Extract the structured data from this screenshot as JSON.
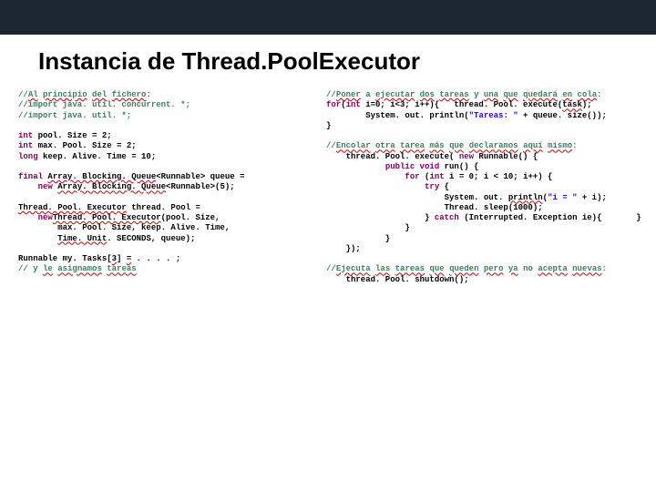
{
  "slide": {
    "title": "Instancia de Thread.PoolExecutor"
  },
  "left": {
    "c1a": "//",
    "c1b": "Al",
    "c1c": " ",
    "c1d": "principio",
    "c1e": " ",
    "c1f": "del",
    "c1g": " ",
    "c1h": "fichero",
    "c1i": ":",
    "c2": "//import java. util. concurrent. *;",
    "c3": "//import java. util. *;",
    "k_int": "int",
    "l4b": " pool. Size = 2;",
    "l5b": " max. Pool. Size = 2;",
    "k_long": "long",
    "l6b": " keep. Alive. Time = 10;",
    "k_final": "final",
    "l7b": " ",
    "l7c": "Array. Blocking. Queue",
    "l7d": "<Runnable> queue =",
    "k_new": "new",
    "l8a": "    ",
    "l8c": " ",
    "l8d": "Array. Blocking. Queue",
    "l8e": "<Runnable>(5);",
    "l9a": "Thread. Pool. Executor",
    "l9b": " thread. Pool =",
    "l10a": "    ",
    "l10c": "Thread. Pool. Executor",
    "l10d": "(pool. Size,",
    "l11": "        max. Pool. Size, keep. Alive. Time,",
    "l12a": "        ",
    "l12b": "Time. Unit",
    "l12c": ". SECONDS, queue);",
    "l13a": "Runnable my. Tasks[",
    "l13b": "3",
    "l13c": "] ",
    "l13d": "=",
    "l13e": " . . . . ;",
    "l14a": "// y ",
    "l14b": "le",
    "l14c": " ",
    "l14d": "asignamos",
    "l14e": " ",
    "l14f": "tareas"
  },
  "right": {
    "c1a": "//",
    "c1b": "Poner",
    "c1c": " a ",
    "c1d": "ejecutar",
    "c1e": " ",
    "c1f": "dos",
    "c1g": " ",
    "c1h": "tareas",
    "c1i": " y ",
    "c1j": "una",
    "c1k": " ",
    "c1l": "que",
    "c1m": " ",
    "c1n": "quedará",
    "c1o": " ",
    "c1p": "en",
    "c1q": " ",
    "c1r": "cola",
    "c1s": ":",
    "k_for": "for",
    "l2a": "(",
    "k_int": "int",
    "l2c": " i=0; i<3; i++){   thread. Pool. execute(",
    "l2d": "task",
    "l2e": ");",
    "l3a": "        System. out. println(",
    "s1": "\"Tareas: \"",
    "l3b": " + queue. size());",
    "l4": "}",
    "c2a": "//",
    "c2b": "Encolar",
    "c2c": " ",
    "c2d": "otra",
    "c2e": " ",
    "c2f": "tarea",
    "c2g": " ",
    "c2h": "más",
    "c2i": " ",
    "c2j": "que",
    "c2k": " ",
    "c2l": "declaramos",
    "c2m": " ",
    "c2n": "aquí",
    "c2o": " ",
    "c2p": "mismo",
    "c2q": ":",
    "l6a": "    thread. Pool. execute( ",
    "k_new": "new",
    "l6b": " Runnable() {",
    "k_public": "public",
    "k_void": "void",
    "l7a": "            ",
    "l7b": " run() {",
    "l8a": "                ",
    "l8b": " (",
    "l8c": " i = 0; i < 10; i++) {",
    "k_try": "try",
    "l9a": "                    ",
    "l9b": " {",
    "l10a": "                        System. out. ",
    "l10b": "println",
    "l10c": "(",
    "s2": "\"i = \"",
    "l10d": " + i);",
    "l11a": "                        Thread. sleep(1000);",
    "k_catch": "catch",
    "l12a": "                    } ",
    "l12b": " (Interrupted. Exception ie){       }",
    "l13": "                }",
    "l14": "            }",
    "l15": "    });",
    "c3a": "//",
    "c3b": "Ejecuta",
    "c3c": " ",
    "c3d": "las",
    "c3e": " ",
    "c3f": "tareas",
    "c3g": " ",
    "c3h": "que",
    "c3i": " ",
    "c3j": "queden",
    "c3k": " ",
    "c3l": "pero",
    "c3m": " ",
    "c3n": "ya",
    "c3o": " no ",
    "c3p": "acepta",
    "c3q": " ",
    "c3r": "nuevas",
    "c3s": ":",
    "l17": "    thread. Pool. shutdown();"
  }
}
